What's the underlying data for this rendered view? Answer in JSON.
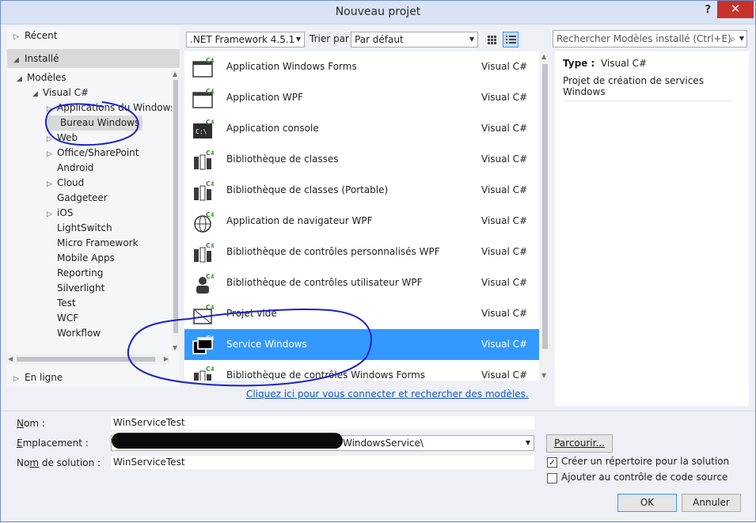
{
  "window": {
    "title": "Nouveau projet",
    "help": "?",
    "close": "✕"
  },
  "left": {
    "recent": "Récent",
    "installed": "Installé",
    "online": "En ligne",
    "tree": [
      {
        "label": "Modèles",
        "level": 0,
        "arrow": "◢"
      },
      {
        "label": "Visual C#",
        "level": 1,
        "arrow": "◢"
      },
      {
        "label": "Applications du Windows",
        "level": 2,
        "arrow": "▷"
      },
      {
        "label": "Bureau Windows",
        "level": 2,
        "arrow": "",
        "selected": true
      },
      {
        "label": "Web",
        "level": 2,
        "arrow": "▷"
      },
      {
        "label": "Office/SharePoint",
        "level": 2,
        "arrow": "▷"
      },
      {
        "label": "Android",
        "level": 2,
        "arrow": ""
      },
      {
        "label": "Cloud",
        "level": 2,
        "arrow": "▷"
      },
      {
        "label": "Gadgeteer",
        "level": 2,
        "arrow": ""
      },
      {
        "label": "iOS",
        "level": 2,
        "arrow": "▷"
      },
      {
        "label": "LightSwitch",
        "level": 2,
        "arrow": ""
      },
      {
        "label": "Micro Framework",
        "level": 2,
        "arrow": ""
      },
      {
        "label": "Mobile Apps",
        "level": 2,
        "arrow": ""
      },
      {
        "label": "Reporting",
        "level": 2,
        "arrow": ""
      },
      {
        "label": "Silverlight",
        "level": 2,
        "arrow": ""
      },
      {
        "label": "Test",
        "level": 2,
        "arrow": ""
      },
      {
        "label": "WCF",
        "level": 2,
        "arrow": ""
      },
      {
        "label": "Workflow",
        "level": 2,
        "arrow": ""
      }
    ]
  },
  "toolbar": {
    "framework": ".NET Framework 4.5.1",
    "sort_label": "Trier par :",
    "sort_value": "Par défaut",
    "search_placeholder": "Rechercher Modèles installé (Ctrl+E)"
  },
  "templates": [
    {
      "name": "Application Windows Forms",
      "lang": "Visual C#",
      "icon": "windows-forms-icon"
    },
    {
      "name": "Application WPF",
      "lang": "Visual C#",
      "icon": "wpf-app-icon"
    },
    {
      "name": "Application console",
      "lang": "Visual C#",
      "icon": "console-icon"
    },
    {
      "name": "Bibliothèque de classes",
      "lang": "Visual C#",
      "icon": "class-library-icon"
    },
    {
      "name": "Bibliothèque de classes (Portable)",
      "lang": "Visual C#",
      "icon": "portable-library-icon"
    },
    {
      "name": "Application de navigateur WPF",
      "lang": "Visual C#",
      "icon": "browser-app-icon"
    },
    {
      "name": "Bibliothèque de contrôles personnalisés WPF",
      "lang": "Visual C#",
      "icon": "custom-control-icon"
    },
    {
      "name": "Bibliothèque de contrôles utilisateur WPF",
      "lang": "Visual C#",
      "icon": "user-control-icon"
    },
    {
      "name": "Projet vide",
      "lang": "Visual C#",
      "icon": "empty-project-icon"
    },
    {
      "name": "Service Windows",
      "lang": "Visual C#",
      "icon": "windows-service-icon",
      "selected": true
    },
    {
      "name": "Bibliothèque de contrôles Windows Forms",
      "lang": "Visual C#",
      "icon": "forms-control-icon"
    }
  ],
  "online_link": "Cliquez ici pour vous connecter et rechercher des modèles.",
  "details": {
    "type_label": "Type :",
    "type_value": "Visual C#",
    "description": "Projet de création de services Windows"
  },
  "form": {
    "name_label": "Nom :",
    "name_value": "WinServiceTest",
    "location_label": "Emplacement :",
    "location_value": "WindowsService\\",
    "solution_label": "Nom de solution :",
    "solution_value": "WinServiceTest",
    "browse": "Parcourir...",
    "create_dir": "Créer un répertoire pour la solution",
    "create_dir_checked": true,
    "add_source": "Ajouter au contrôle de code source",
    "add_source_checked": false,
    "ok": "OK",
    "cancel": "Annuler"
  },
  "colors": {
    "selection": "#3399ff",
    "annotation": "#1a22c8",
    "close": "#c7322d"
  }
}
